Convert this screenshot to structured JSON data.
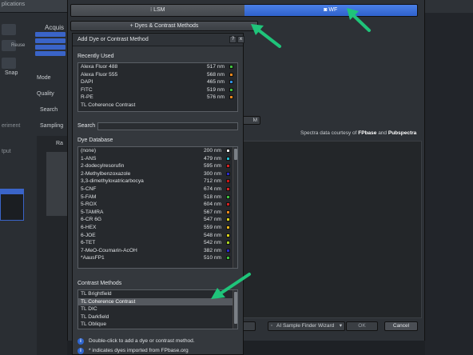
{
  "background": {
    "app_title": "plications",
    "acquisition_label": "Acquis",
    "reuse_label": "Reuse",
    "snap_label": "Snap",
    "mode_label": "Mode",
    "quality_label": "Quality",
    "search_label": "Search",
    "sampling_label": "Sampling",
    "experiment_label": "eriment",
    "output_label": "tput",
    "ra_label": "Ra",
    "m_label": "M"
  },
  "mode_selector": {
    "lsm_label": "LSM",
    "wf_label": "WF"
  },
  "dyes_button_label": "+ Dyes & Contrast Methods",
  "spectra_note": {
    "prefix": "Spectra data courtesy of ",
    "source1": "FPbase",
    "mid": " and ",
    "source2": "Pubspectra"
  },
  "footer_buttons": {
    "wizard_label": "AI Sample Finder Wizard",
    "ok_label": "OK",
    "cancel_label": "Cancel"
  },
  "dialog": {
    "title": "Add Dye or Contrast Method",
    "help_glyph": "?",
    "close_glyph": "x",
    "recently_used_label": "Recently Used",
    "recently_used": [
      {
        "name": "Alexa Fluor 488",
        "nm": "517 nm",
        "color": "#3fbf3f"
      },
      {
        "name": "Alexa Fluor 555",
        "nm": "568 nm",
        "color": "#e8861c"
      },
      {
        "name": "DAPI",
        "nm": "465 nm",
        "color": "#2f8fe0"
      },
      {
        "name": "FITC",
        "nm": "519 nm",
        "color": "#3fbf3f"
      },
      {
        "name": "R-PE",
        "nm": "576 nm",
        "color": "#e8861c"
      },
      {
        "name": "TL Coherence Contrast",
        "nm": "",
        "color": ""
      }
    ],
    "search_label": "Search",
    "search_value": "",
    "dye_database_label": "Dye Database",
    "dye_database": [
      {
        "name": "(none)",
        "nm": "200 nm",
        "color": "#e8e8e8"
      },
      {
        "name": "1-ANS",
        "nm": "479 nm",
        "color": "#1fb6c9"
      },
      {
        "name": "2-dodecylresorufin",
        "nm": "595 nm",
        "color": "#d42020"
      },
      {
        "name": "2-Methylbenzoxazole",
        "nm": "300 nm",
        "color": "#2a2acb"
      },
      {
        "name": "3,3-dimethyloxatricarbocya",
        "nm": "712 nm",
        "color": "#c81414"
      },
      {
        "name": "5-CNF",
        "nm": "674 nm",
        "color": "#d42020"
      },
      {
        "name": "5-FAM",
        "nm": "518 nm",
        "color": "#3fbf3f"
      },
      {
        "name": "5-ROX",
        "nm": "604 nm",
        "color": "#d42020"
      },
      {
        "name": "5-TAMRA",
        "nm": "567 nm",
        "color": "#e8861c"
      },
      {
        "name": "6-CR 6G",
        "nm": "547 nm",
        "color": "#d9d21a"
      },
      {
        "name": "6-HEX",
        "nm": "559 nm",
        "color": "#e8b51c"
      },
      {
        "name": "6-JOE",
        "nm": "548 nm",
        "color": "#d9d21a"
      },
      {
        "name": "6-TET",
        "nm": "542 nm",
        "color": "#a8d420"
      },
      {
        "name": "7-MeO-Coumarin-AcOH",
        "nm": "382 nm",
        "color": "#2a2acb"
      },
      {
        "name": "*AausFP1",
        "nm": "510 nm",
        "color": "#3fbf3f"
      }
    ],
    "contrast_methods_label": "Contrast Methods",
    "contrast_methods": [
      {
        "name": "TL Brightfield",
        "selected": false
      },
      {
        "name": "TL Coherence Contrast",
        "selected": true
      },
      {
        "name": "TL DIC",
        "selected": false
      },
      {
        "name": "TL Darkfield",
        "selected": false
      },
      {
        "name": "TL Oblique",
        "selected": false
      }
    ],
    "info_glyph": "i",
    "info_double_click": "Double-click to add a dye or contrast method.",
    "info_fpbase": "* indicates dyes imported from FPbase.org"
  },
  "colors": {
    "accent_blue": "#2f62cc",
    "annotation_arrow": "#1fc47a"
  }
}
